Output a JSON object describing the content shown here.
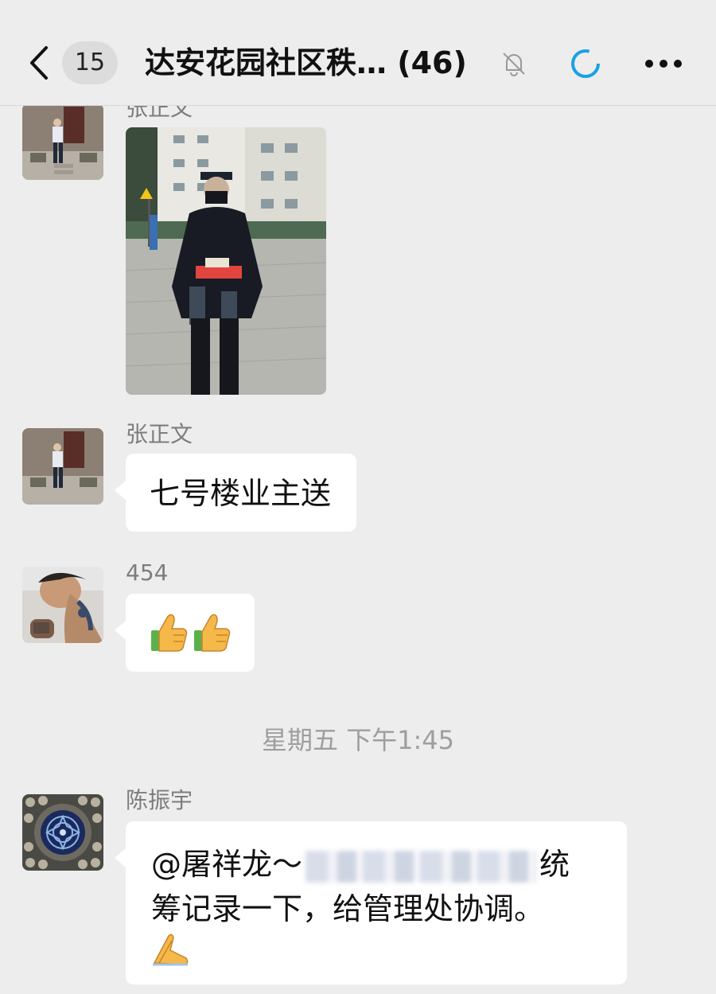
{
  "header": {
    "back_icon": "chevron-left-icon",
    "unread_count": "15",
    "title": "达安花园社区秩… (46)",
    "mute_icon": "bell-off-icon",
    "status_icon": "loading-ring-icon",
    "more_icon": "ellipsis-icon"
  },
  "messages": [
    {
      "sender": "张正文",
      "type": "image",
      "image_desc": "security-guard-holding-gift-photo"
    },
    {
      "sender": "张正文",
      "type": "text",
      "text": "七号楼业主送"
    },
    {
      "sender": "454",
      "type": "emoji",
      "emoji": [
        "thumbs-up",
        "thumbs-up"
      ]
    },
    {
      "sender": "陈振宇",
      "type": "text",
      "line1_prefix": "@屠祥龙～",
      "line1_suffix": "统",
      "line2": "筹记录一下，给管理处协调。",
      "emoji": "folded-hands"
    }
  ],
  "timestamp": "星期五 下午1:45",
  "colors": {
    "background": "#ededed",
    "bubble": "#ffffff",
    "meta_text": "#7d7d7d",
    "accent": "#1aa0e6"
  }
}
